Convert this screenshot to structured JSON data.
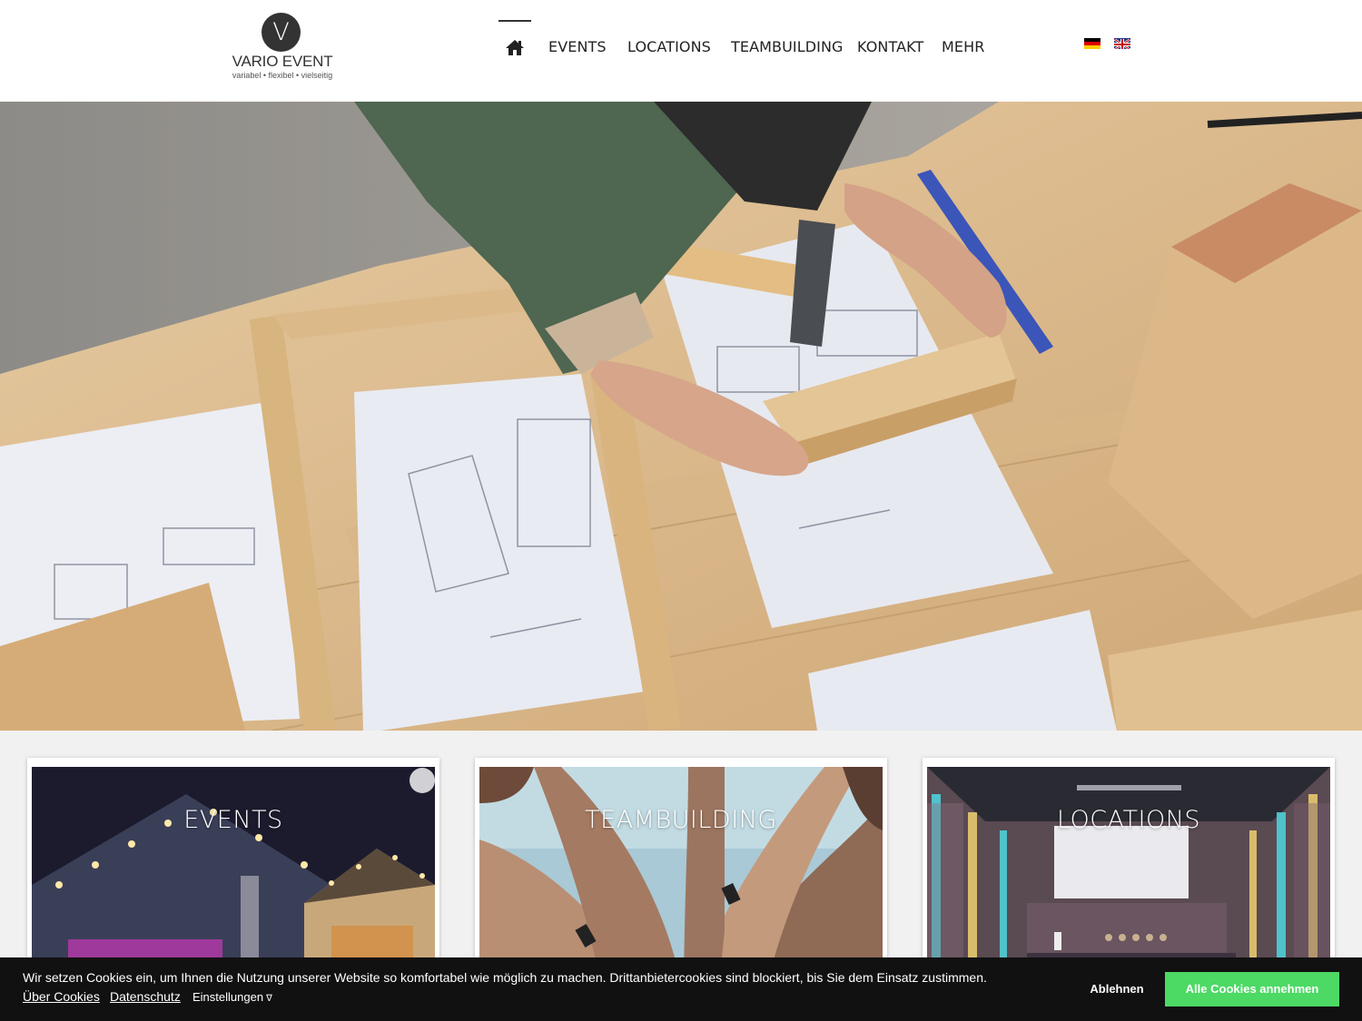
{
  "logo": {
    "letter": "V",
    "name": "VARIO EVENT",
    "tagline": "variabel • flexibel • vielseitig"
  },
  "nav": {
    "home_icon": "home-icon",
    "items": [
      {
        "label": "EVENTS"
      },
      {
        "label": "LOCATIONS"
      },
      {
        "label": "TEAMBUILDING"
      },
      {
        "label": "KONTAKT"
      },
      {
        "label": "MEHR"
      }
    ]
  },
  "languages": [
    {
      "icon": "german-flag-icon"
    },
    {
      "icon": "uk-flag-icon"
    }
  ],
  "hero": {
    "image": "woodworking-teambuilding-photo"
  },
  "cards": [
    {
      "title": "EVENTS",
      "image": "event-houses-night-photo"
    },
    {
      "title": "TEAMBUILDING",
      "image": "team-hands-photo"
    },
    {
      "title": "LOCATIONS",
      "image": "event-hall-photo"
    }
  ],
  "cookie": {
    "message": "Wir setzen Cookies ein, um Ihnen die Nutzung unserer Website so komfortabel wie möglich zu machen. Drittanbietercookies sind blockiert, bis Sie dem Einsatz zustimmen.",
    "link_about": "Über Cookies",
    "link_privacy": "Datenschutz",
    "settings_label": "Einstellungen",
    "decline_label": "Ablehnen",
    "accept_label": "Alle Cookies annehmen"
  },
  "colors": {
    "accept_button": "#4cd964",
    "cookie_bar": "#111111",
    "text": "#222222"
  }
}
